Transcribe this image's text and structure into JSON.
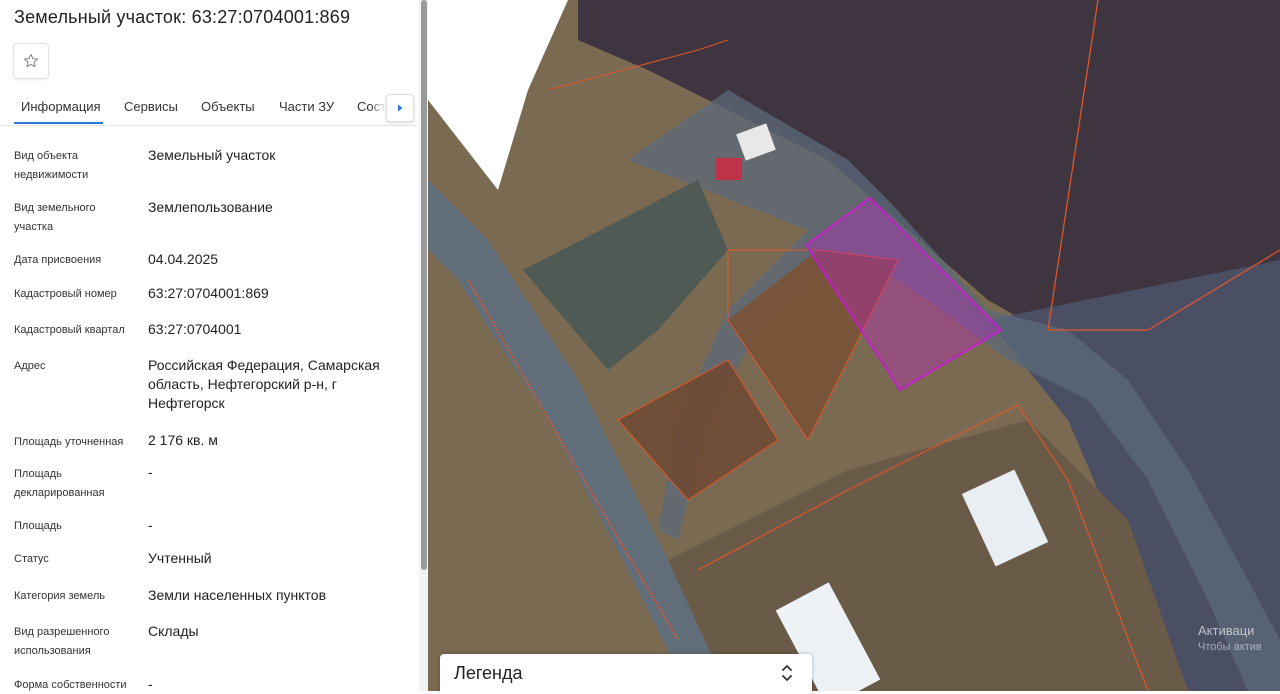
{
  "panel": {
    "title": "Земельный участок: 63:27:0704001:869",
    "favorite_icon": "star-outline-icon"
  },
  "tabs": [
    {
      "label": "Информация",
      "active": true
    },
    {
      "label": "Сервисы"
    },
    {
      "label": "Объекты"
    },
    {
      "label": "Части ЗУ"
    },
    {
      "label": "Сост"
    }
  ],
  "tabs_more_icon": "caret-right-icon",
  "accent_color": "#2b7bd5",
  "rows": [
    {
      "label": "Вид объекта недвижимости",
      "value": "Земельный участок"
    },
    {
      "label": "Вид земельного участка",
      "value": "Землепользование"
    },
    {
      "label": "Дата присвоения",
      "value": "04.04.2025"
    },
    {
      "label": "Кадастровый номер",
      "value": "63:27:0704001:869"
    },
    {
      "label": "Кадастровый квартал",
      "value": "63:27:0704001"
    },
    {
      "label": "Адрес",
      "value": "Российская Федерация, Самарская область, Нефтегорский р-н, г Нефтегорск"
    },
    {
      "label": "Площадь уточненная",
      "value": "2 176 кв. м"
    },
    {
      "label": "Площадь декларированная",
      "value": "-"
    },
    {
      "label": "Площадь",
      "value": "-"
    },
    {
      "label": "Статус",
      "value": "Учтенный"
    },
    {
      "label": "Категория земель",
      "value": "Земли населенных пунктов"
    },
    {
      "label": "Вид разрешенного использования",
      "value": "Склады"
    },
    {
      "label": "Форма собственности",
      "value": "-"
    }
  ],
  "map": {
    "selected_parcel_color": "#c020c8",
    "boundary_color": "#e0552a"
  },
  "legend": {
    "label": "Легенда",
    "icon": "chevron-up-down-icon"
  },
  "watermark": {
    "line1": "Активаци",
    "line2": "Чтобы актив"
  }
}
